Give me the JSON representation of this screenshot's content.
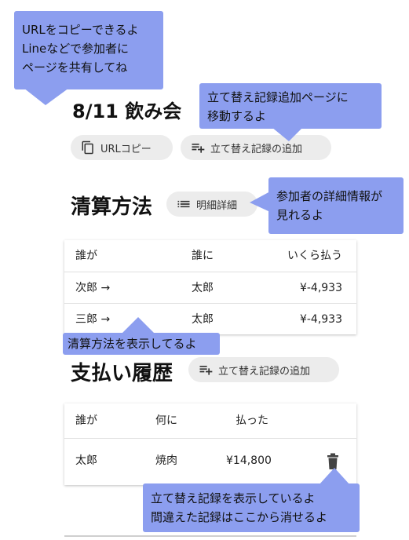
{
  "event_title": "8/11 飲み会",
  "toolbar": {
    "copy_url_label": "URLコピー",
    "add_record_label": "立て替え記録の追加"
  },
  "settlement": {
    "heading": "清算方法",
    "details_button_label": "明細詳細",
    "columns": [
      "誰が",
      "誰に",
      "いくら払う"
    ],
    "rows": [
      {
        "from": "次郎 →",
        "to": "太郎",
        "amount": "¥-4,933"
      },
      {
        "from": "三郎 →",
        "to": "太郎",
        "amount": "¥-4,933"
      }
    ]
  },
  "history": {
    "heading": "支払い履歴",
    "add_record_label": "立て替え記録の追加",
    "columns": [
      "誰が",
      "何に",
      "払った"
    ],
    "rows": [
      {
        "who": "太郎",
        "what": "焼肉",
        "paid": "¥14,800"
      }
    ]
  },
  "tooltips": {
    "url_copy": [
      "URLをコピーできるよ",
      "Lineなどで参加者に",
      "ページを共有してね"
    ],
    "add_record": [
      "立て替え記録追加ページに",
      "移動するよ"
    ],
    "participants": [
      "参加者の詳細情報が",
      "見れるよ"
    ],
    "settlement": [
      "清算方法を表示してるよ"
    ],
    "history": [
      "立て替え記録を表示しているよ",
      "間違えた記録はここから消せるよ"
    ]
  },
  "colors": {
    "tooltip_bg": "#8c9eef",
    "pill_bg": "#ececec"
  },
  "icons": {
    "copy": "copy-icon",
    "playlist_add": "playlist-add-icon",
    "list": "list-icon",
    "delete": "trash-icon"
  }
}
